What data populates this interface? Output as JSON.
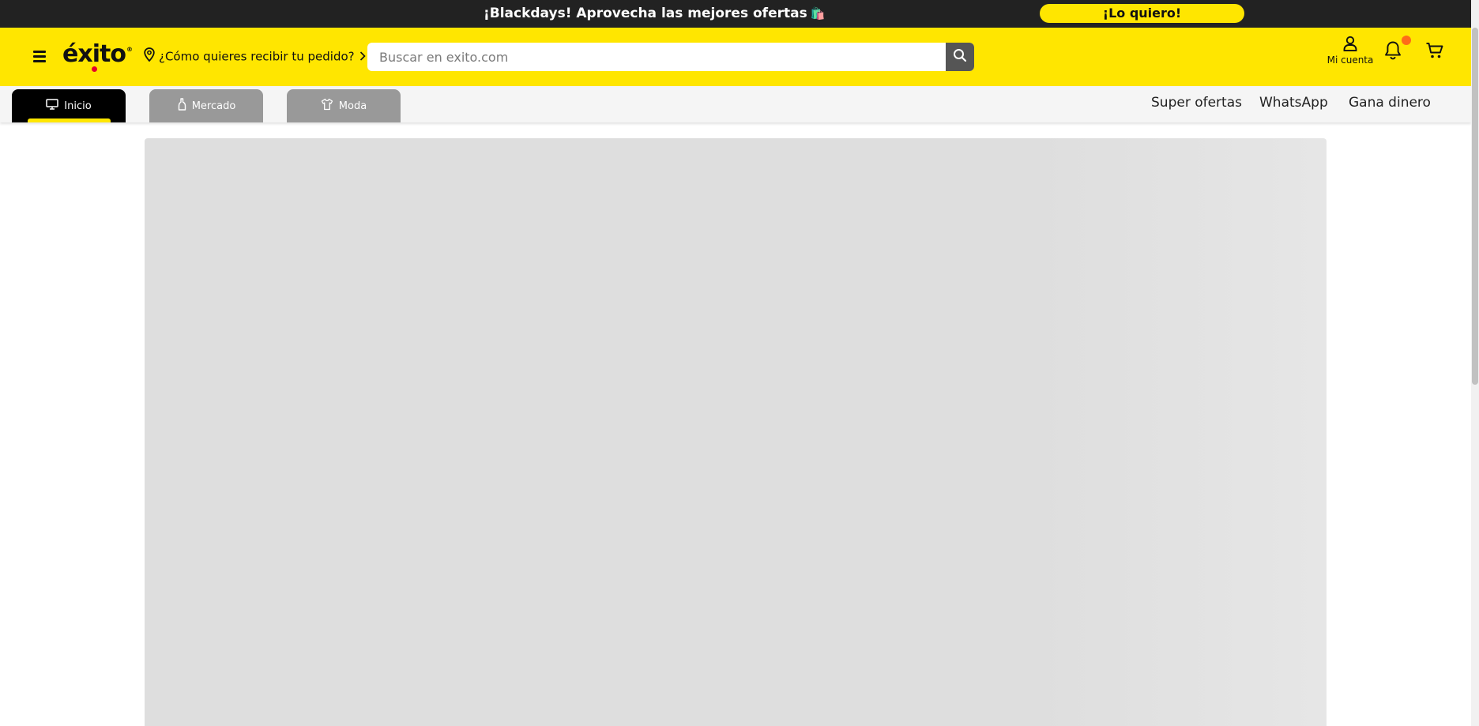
{
  "promo": {
    "text": "¡Blackdays! Aprovecha las mejores ofertas",
    "emoji": "🛍️",
    "cta": "¡Lo quiero!"
  },
  "header": {
    "logo": "éxito",
    "delivery": "¿Cómo quieres recibir tu pedido?",
    "search_placeholder": "Buscar en exito.com",
    "account_label": "Mi cuenta"
  },
  "nav": {
    "tabs": [
      {
        "label": "Inicio",
        "icon": "monitor-icon",
        "active": true
      },
      {
        "label": "Mercado",
        "icon": "bottle-icon",
        "active": false
      },
      {
        "label": "Moda",
        "icon": "shirt-icon",
        "active": false
      }
    ],
    "links": [
      "Super ofertas",
      "WhatsApp",
      "Gana dinero"
    ]
  },
  "colors": {
    "brand_yellow": "#ffe600",
    "promo_bg": "#222222",
    "notification_dot": "#ff6b19",
    "banner_placeholder": "#dedede"
  }
}
